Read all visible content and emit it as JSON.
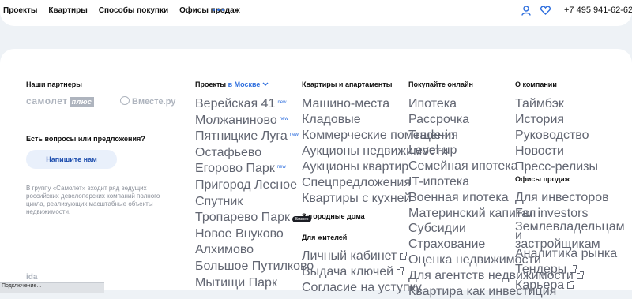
{
  "header": {
    "nav": [
      "Проекты",
      "Квартиры",
      "Способы покупки",
      "Офисы продаж"
    ],
    "phone": "+7 495 941-62-62",
    "icons": [
      "user-icon",
      "heart-icon",
      "more-dots-icon"
    ]
  },
  "footer": {
    "partners_title": "Наши партнеры",
    "partner_logo_1_main": "самолет",
    "partner_logo_1_plus": "плюс",
    "partner_logo_2": "Вместе.ру",
    "question": "Есть вопросы или предложения?",
    "write_button": "Напишите нам",
    "about_text": "В группу «Самолет» входит ряд ведущих российских девелоперских компаний полного цикла, реализующих масштабные объекты недвижимости.",
    "bottom_logo": "ida",
    "status_text": "Подключение..."
  },
  "projects": {
    "title_prefix": "Проекты",
    "title_city": "в Москве",
    "items": [
      {
        "label": "Верейская 41",
        "tag": "new"
      },
      {
        "label": "Молжаниново",
        "tag": "new"
      },
      {
        "label": "Пятницкие Луга",
        "tag": "new"
      },
      {
        "label": "Остафьево",
        "tag": ""
      },
      {
        "label": "Егорово Парк",
        "tag": "new"
      },
      {
        "label": "Пригород Лесное",
        "tag": ""
      },
      {
        "label": "Спутник",
        "tag": ""
      },
      {
        "label": "Тропарево Парк",
        "tag": "Бизнес"
      },
      {
        "label": "Новое Внуково",
        "tag": ""
      },
      {
        "label": "Алхимово",
        "tag": ""
      },
      {
        "label": "Большое Путилково",
        "tag": ""
      },
      {
        "label": "Мытищи Парк",
        "tag": ""
      }
    ]
  },
  "apartments": {
    "title": "Квартиры и апартаменты",
    "items": [
      "Машино-места",
      "Кладовые",
      "Коммерческие помещения",
      "Аукционы недвижимости",
      "Аукционы квартир",
      "Спецпредложения",
      "Квартиры с кухней"
    ],
    "country_title": "Загородные дома",
    "residents_title": "Для жителей",
    "residents_items": [
      "Личный кабинет",
      "Выдача ключей",
      "Согласие на уступку"
    ]
  },
  "buy_online": {
    "title": "Покупайте онлайн",
    "items": [
      "Ипотека",
      "Рассрочка",
      "Trade-in",
      "Level-up",
      "Семейная ипотека",
      "IT-ипотека",
      "Военная ипотека",
      "Материнский капитал",
      "Субсидии",
      "Страхование",
      "Оценка недвижимости",
      "Для агентств недвижимости",
      "Квартира как инвестиция"
    ]
  },
  "company": {
    "title": "О компании",
    "items": [
      "Таймбэк",
      "История",
      "Руководство",
      "Новости",
      "Пресс-релизы"
    ],
    "offices_title": "Офисы продаж",
    "items2": [
      "Для инвесторов",
      "For investors",
      "Землевладельцам и застройщикам",
      "Аналитика рынка",
      "Тендеры",
      "Карьера"
    ]
  }
}
